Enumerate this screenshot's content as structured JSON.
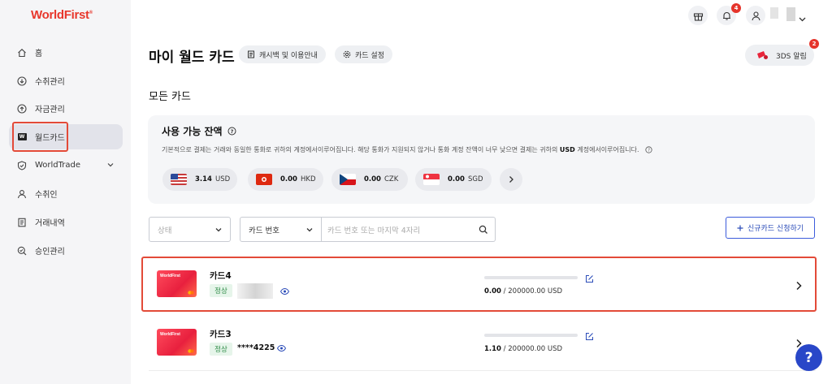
{
  "brand": {
    "logo": "WorldFirst",
    "color": "#e8372c"
  },
  "sidebar": {
    "items": [
      {
        "label": "홈",
        "icon": "home-icon"
      },
      {
        "label": "수취관리",
        "icon": "receive-icon"
      },
      {
        "label": "자금관리",
        "icon": "funds-icon"
      },
      {
        "label": "월드카드",
        "icon": "worldcard-icon",
        "active": true
      },
      {
        "label": "WorldTrade",
        "icon": "worldtrade-icon"
      },
      {
        "label": "수취인",
        "icon": "recipient-icon"
      },
      {
        "label": "거래내역",
        "icon": "transactions-icon"
      },
      {
        "label": "승인관리",
        "icon": "approval-icon"
      }
    ]
  },
  "topbar": {
    "notification_count": "4",
    "tds_count": "2"
  },
  "header": {
    "title": "마이 월드 카드",
    "cashback_label": "캐시백 및 이용안내",
    "settings_label": "카드 설정",
    "tds_label": "3DS 알림"
  },
  "section_title": "모든 카드",
  "balance": {
    "title": "사용 가능 잔액",
    "desc_pre": "기본적으로 결제는 거래와 동일한 통화로 귀하의 계정에서이루어집니다. 해당 통화가 지원되지 않거나 통화 계정 잔액이 너무 낮으면 결제는 귀하의 ",
    "desc_bold": "USD",
    "desc_post": " 계정에서이루어집니다.",
    "currencies": [
      {
        "amount": "3.14",
        "code": "USD"
      },
      {
        "amount": "0.00",
        "code": "HKD"
      },
      {
        "amount": "0.00",
        "code": "CZK"
      },
      {
        "amount": "0.00",
        "code": "SGD"
      }
    ]
  },
  "filters": {
    "status_placeholder": "상태",
    "field_select": "카드 번호",
    "search_placeholder": "카드 번호 또는 마지막 4자리",
    "new_card_label": "신규카드 신청하기"
  },
  "cards": [
    {
      "name": "카드4",
      "status": "정상",
      "number": "",
      "used": "0.00",
      "limit": " / 200000.00 USD",
      "progress": 0,
      "card_logo": "WorldFirst"
    },
    {
      "name": "카드3",
      "status": "정상",
      "number": "****4225",
      "used": "1.10",
      "limit": " / 200000.00 USD",
      "progress": 5.5e-06,
      "card_logo": "WorldFirst"
    }
  ],
  "help_label": "?"
}
